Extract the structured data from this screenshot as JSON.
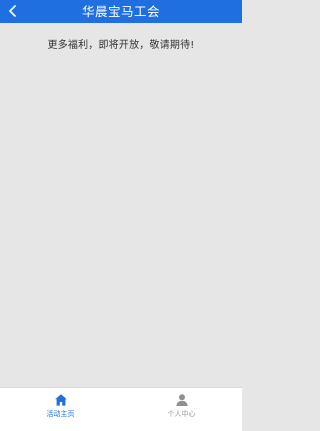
{
  "header": {
    "title": "华晨宝马工会",
    "back_icon": "chevron-left-icon"
  },
  "main": {
    "notice": "更多福利，即将开放，敬请期待!"
  },
  "tabbar": {
    "tabs": [
      {
        "label": "活动主页",
        "icon": "home-icon",
        "active": true
      },
      {
        "label": "个人中心",
        "icon": "user-icon",
        "active": false
      }
    ]
  },
  "colors": {
    "accent": "#1f6fe0",
    "background": "#e6e6e6",
    "tab_inactive": "#999999"
  }
}
